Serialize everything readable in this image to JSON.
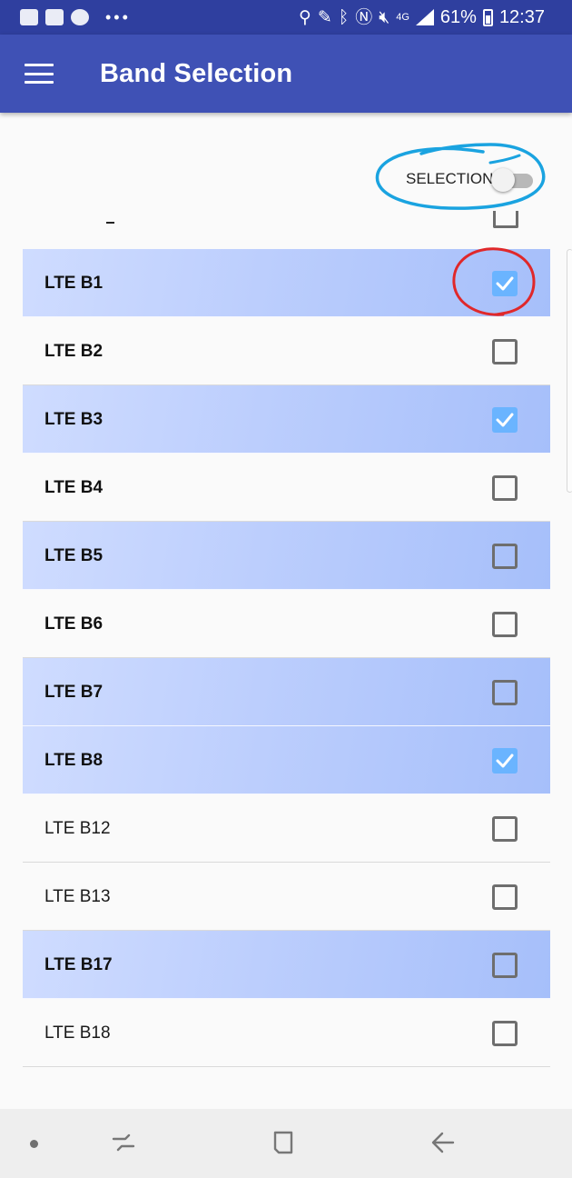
{
  "status_bar": {
    "battery": "61%",
    "time": "12:37",
    "network": "4G",
    "icons": [
      "gallery-icon",
      "notification-icon",
      "line-icon",
      "location-icon",
      "nfc-icon",
      "bluetooth-icon",
      "mute-icon",
      "signal-icon",
      "battery-icon"
    ]
  },
  "app_bar": {
    "title": "Band Selection",
    "menu_icon": "hamburger-menu-icon"
  },
  "selection_toggle": {
    "label": "SELECTION",
    "on": false
  },
  "partial_row": {
    "label": "-"
  },
  "bands": [
    {
      "label": "LTE B1",
      "checked": true,
      "highlighted": true,
      "bold": true
    },
    {
      "label": "LTE B2",
      "checked": false,
      "highlighted": false,
      "bold": true
    },
    {
      "label": "LTE B3",
      "checked": true,
      "highlighted": true,
      "bold": true
    },
    {
      "label": "LTE B4",
      "checked": false,
      "highlighted": false,
      "bold": true
    },
    {
      "label": "LTE B5",
      "checked": false,
      "highlighted": true,
      "bold": true
    },
    {
      "label": "LTE B6",
      "checked": false,
      "highlighted": false,
      "bold": true
    },
    {
      "label": "LTE B7",
      "checked": false,
      "highlighted": true,
      "bold": true
    },
    {
      "label": "LTE B8",
      "checked": true,
      "highlighted": true,
      "bold": true
    },
    {
      "label": "LTE B12",
      "checked": false,
      "highlighted": false,
      "bold": false
    },
    {
      "label": "LTE B13",
      "checked": false,
      "highlighted": false,
      "bold": false
    },
    {
      "label": "LTE B17",
      "checked": false,
      "highlighted": true,
      "bold": true
    },
    {
      "label": "LTE B18",
      "checked": false,
      "highlighted": false,
      "bold": false
    }
  ],
  "colors": {
    "status_bar": "#2f3f9f",
    "app_bar": "#3f51b5",
    "highlight": "#bccefd",
    "checkbox_checked": "#6ab4ff",
    "annotation_blue": "#1aa3e0",
    "annotation_red": "#e0282a"
  },
  "nav_bar": {
    "buttons": [
      "recents-icon",
      "home-icon",
      "back-icon"
    ]
  }
}
